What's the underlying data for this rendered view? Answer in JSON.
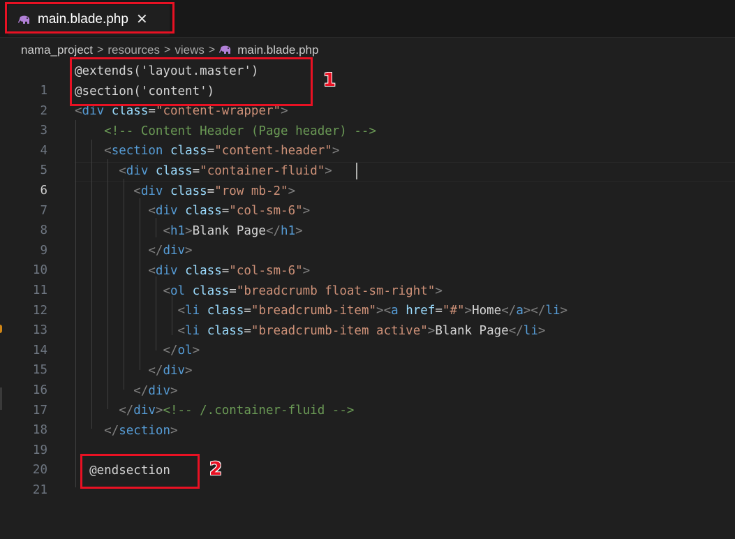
{
  "tab": {
    "label": "main.blade.php",
    "close_glyph": "✕",
    "icon": "elephant-icon",
    "icon_color": "#b180d7"
  },
  "breadcrumb": {
    "items": [
      "nama_project",
      "resources",
      "views"
    ],
    "file": "main.blade.php",
    "separator": ">"
  },
  "editor": {
    "active_line": 6,
    "lines": [
      {
        "n": "1"
      },
      {
        "n": "2"
      },
      {
        "n": "3"
      },
      {
        "n": "4"
      },
      {
        "n": "5"
      },
      {
        "n": "6"
      },
      {
        "n": "7"
      },
      {
        "n": "8"
      },
      {
        "n": "9"
      },
      {
        "n": "10"
      },
      {
        "n": "11"
      },
      {
        "n": "12"
      },
      {
        "n": "13"
      },
      {
        "n": "14"
      },
      {
        "n": "15"
      },
      {
        "n": "16"
      },
      {
        "n": "17"
      },
      {
        "n": "18"
      },
      {
        "n": "19"
      },
      {
        "n": "20"
      },
      {
        "n": "21"
      }
    ],
    "code": {
      "l1": "@extends('layout.master')",
      "l2": "@section('content')",
      "l3_tag": "div",
      "l3_attr": "class",
      "l3_val": "\"content-wrapper\"",
      "l4": "<!-- Content Header (Page header) -->",
      "l5_tag": "section",
      "l5_attr": "class",
      "l5_val": "\"content-header\"",
      "l6_tag": "div",
      "l6_attr": "class",
      "l6_val": "\"container-fluid\"",
      "l7_tag": "div",
      "l7_attr": "class",
      "l7_val": "\"row mb-2\"",
      "l8_tag": "div",
      "l8_attr": "class",
      "l8_val": "\"col-sm-6\"",
      "l9_tag": "h1",
      "l9_text": "Blank Page",
      "l9_close": "h1",
      "l10_close": "div",
      "l11_tag": "div",
      "l11_attr": "class",
      "l11_val": "\"col-sm-6\"",
      "l12_tag": "ol",
      "l12_attr": "class",
      "l12_val": "\"breadcrumb float-sm-right\"",
      "l13_tag": "li",
      "l13_attr": "class",
      "l13_val": "\"breadcrumb-item\"",
      "l13_a": "a",
      "l13_href": "href",
      "l13_href_val": "\"#\"",
      "l13_text": "Home",
      "l13_aclose": "a",
      "l13_liclose": "li",
      "l14_tag": "li",
      "l14_attr": "class",
      "l14_val": "\"breadcrumb-item active\"",
      "l14_text": "Blank Page",
      "l14_close": "li",
      "l15_close": "ol",
      "l16_close": "div",
      "l17_close": "div",
      "l18_close": "div",
      "l18_cmt": "<!-- /.container-fluid -->",
      "l19_close": "section",
      "l21": "@endsection"
    }
  },
  "annotations": {
    "one": "1",
    "two": "2",
    "color": "#e81123"
  }
}
